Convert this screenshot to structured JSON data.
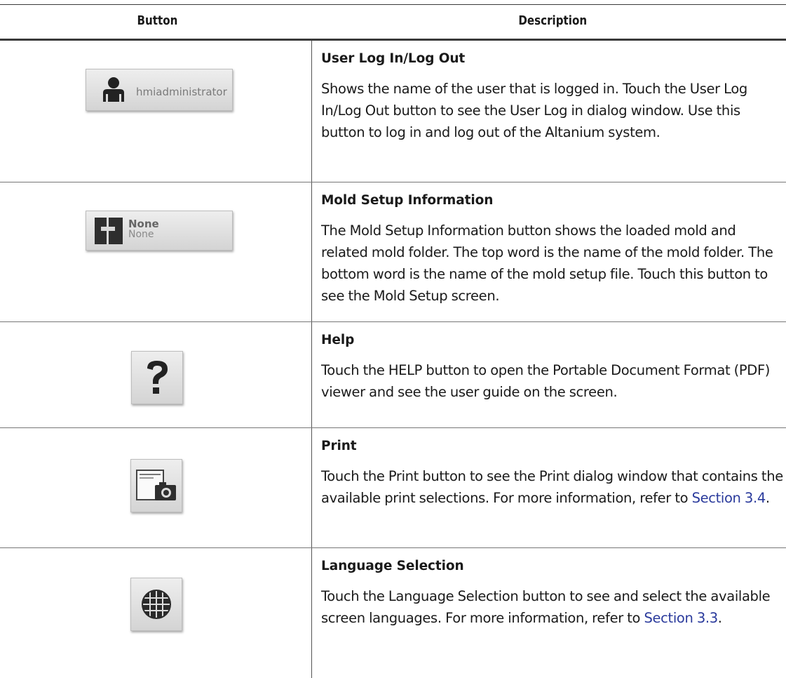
{
  "header": {
    "col1": "Button",
    "col2": "Description"
  },
  "rows": [
    {
      "title": "User Log In/Log Out",
      "body": "Shows the name of the user that is logged in. Touch the User Log In/Log Out button to see the User Log in dialog window. Use this button to log in and log out of the Altanium system.",
      "button": {
        "icon": "user-icon",
        "label": "hmiadministrator"
      }
    },
    {
      "title": "Mold Setup Information",
      "body": "The Mold Setup Information button shows the loaded mold and related mold folder. The top word is the name of the mold folder. The bottom word is the name of the mold setup file. Touch this button to see the Mold Setup screen.",
      "button": {
        "icon": "mold-icon",
        "top": "None",
        "bottom": "None"
      }
    },
    {
      "title": "Help",
      "body": "Touch the HELP button to open the Portable Document Format (PDF) viewer and see the user guide on the screen.",
      "button": {
        "icon": "help-question-icon"
      }
    },
    {
      "title": "Print",
      "body": "Touch the Print button to see the Print dialog window that contains the available print selections. For more information, refer to",
      "link": "Section 3.4",
      "trail": ".",
      "button": {
        "icon": "print-screenshot-icon"
      }
    },
    {
      "title": "Language Selection",
      "body": "Touch the Language Selection button to see and select the available screen languages. For more information, refer to",
      "link": "Section 3.3",
      "trail": ".",
      "button": {
        "icon": "globe-icon"
      }
    }
  ]
}
